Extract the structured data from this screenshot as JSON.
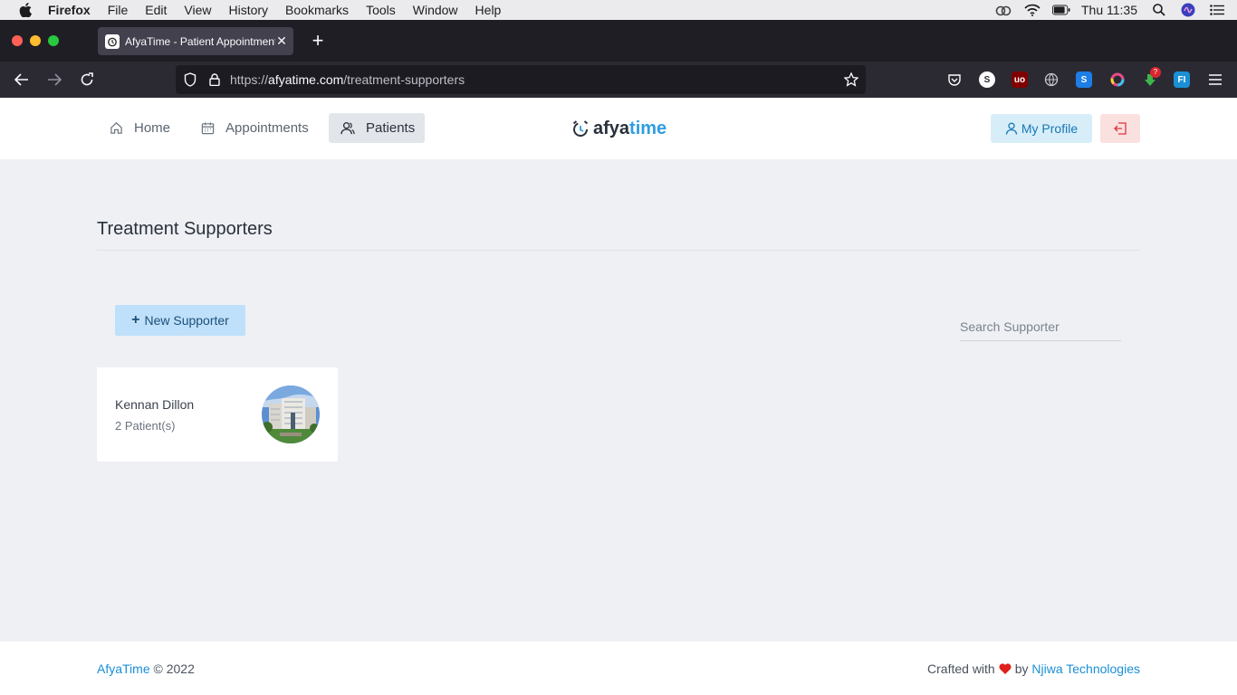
{
  "menubar": {
    "app": "Firefox",
    "items": [
      "File",
      "Edit",
      "View",
      "History",
      "Bookmarks",
      "Tools",
      "Window",
      "Help"
    ],
    "clock": "Thu 11:35"
  },
  "browser": {
    "tab_title": "AfyaTime - Patient Appointment",
    "url_scheme": "https://",
    "url_host": "afyatime.com",
    "url_path": "/treatment-supporters",
    "badge_count": "?"
  },
  "nav": {
    "home": "Home",
    "appointments": "Appointments",
    "patients": "Patients",
    "logo_a": "afya",
    "logo_b": "time",
    "profile": "My Profile"
  },
  "main": {
    "title": "Treatment Supporters",
    "new_button": "New Supporter",
    "search_placeholder": "Search Supporter",
    "supporters": [
      {
        "name": "Kennan Dillon",
        "patients": "2 Patient(s)"
      }
    ]
  },
  "footer": {
    "brand": "AfyaTime",
    "copyright": "© 2022",
    "crafted": "Crafted with",
    "by": "by",
    "company": "Njiwa Technologies"
  },
  "colors": {
    "accent": "#2f9ee0",
    "page_bg": "#eef0f4",
    "heart": "#e0201b"
  }
}
